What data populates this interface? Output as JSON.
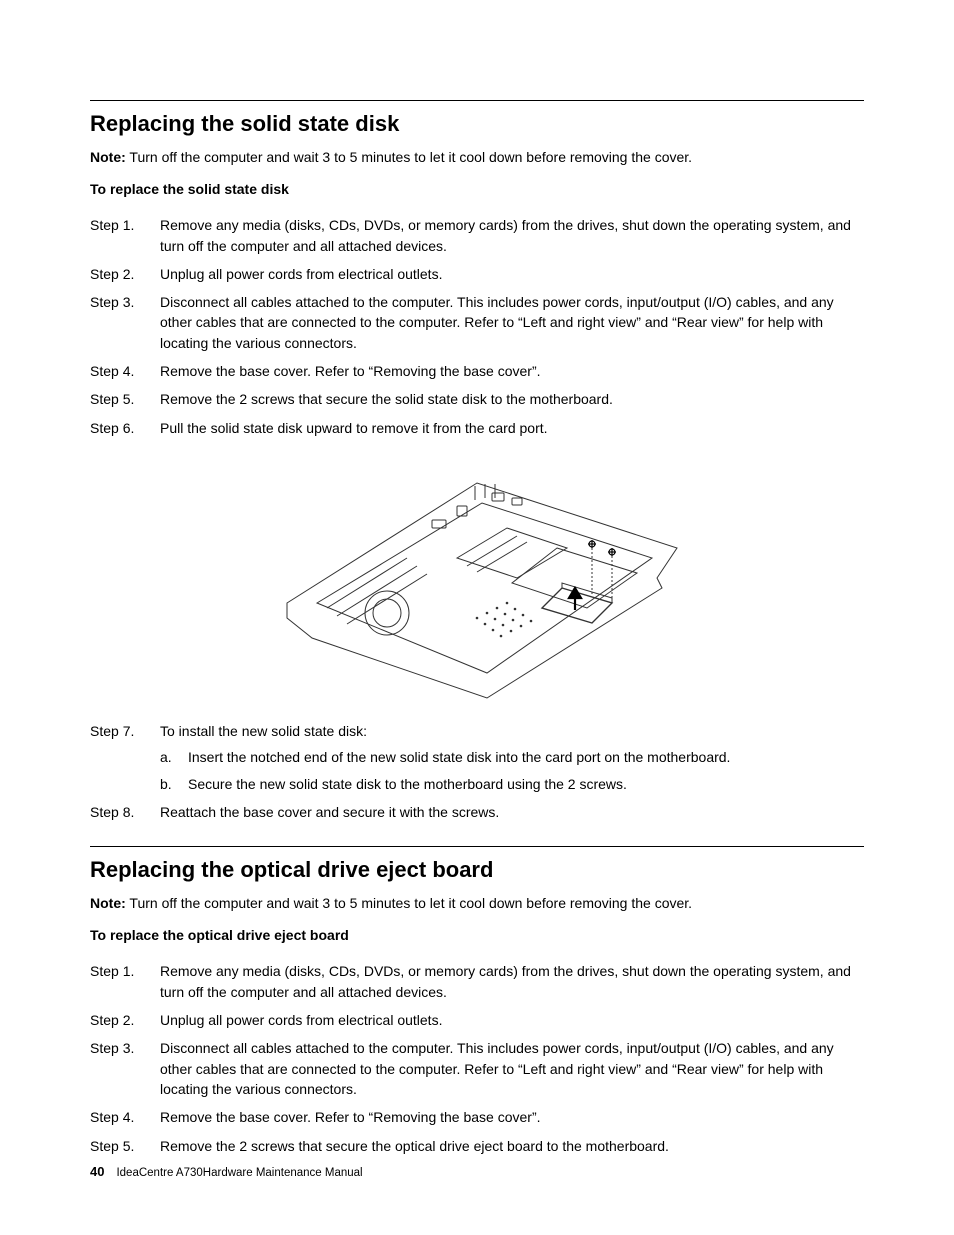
{
  "section1": {
    "title": "Replacing the solid state disk",
    "note_label": "Note:",
    "note_text": " Turn off the computer and wait 3 to 5 minutes to let it cool down before removing the cover.",
    "sub_heading": "To replace the solid state disk",
    "steps": [
      {
        "label": "Step 1.",
        "text": "Remove any media (disks, CDs, DVDs, or memory cards) from the drives, shut down the operating system, and turn off the computer and all attached devices."
      },
      {
        "label": "Step 2.",
        "text": "Unplug all power cords from electrical outlets."
      },
      {
        "label": "Step 3.",
        "text": "Disconnect all cables attached to the computer. This includes power cords, input/output (I/O) cables, and any other cables that are connected to the computer. Refer to “Left and right view” and “Rear view” for help with locating the various connectors."
      },
      {
        "label": "Step 4.",
        "text": "Remove the base cover. Refer to “Removing the base cover”."
      },
      {
        "label": "Step 5.",
        "text": "Remove the 2 screws that secure the solid state disk to the motherboard."
      },
      {
        "label": "Step 6.",
        "text": "Pull the solid state disk upward to remove it from the card port."
      }
    ],
    "step7": {
      "label": "Step 7.",
      "text": "To install the new solid state disk:",
      "sub": [
        {
          "label": "a.",
          "text": "Insert the notched end of the new solid state disk into the card port on the motherboard."
        },
        {
          "label": "b.",
          "text": "Secure the new solid state disk to the motherboard using the 2 screws."
        }
      ]
    },
    "step8": {
      "label": "Step 8.",
      "text": "Reattach the base cover and secure it with the screws."
    }
  },
  "section2": {
    "title": "Replacing the optical drive eject board",
    "note_label": "Note:",
    "note_text": " Turn off the computer and wait 3 to 5 minutes to let it cool down before removing the cover.",
    "sub_heading": "To replace the optical drive eject board",
    "steps": [
      {
        "label": "Step 1.",
        "text": "Remove any media (disks, CDs, DVDs, or memory cards) from the drives, shut down the operating system, and turn off the computer and all attached devices."
      },
      {
        "label": "Step 2.",
        "text": "Unplug all power cords from electrical outlets."
      },
      {
        "label": "Step 3.",
        "text": "Disconnect all cables attached to the computer. This includes power cords, input/output (I/O) cables, and any other cables that are connected to the computer. Refer to “Left and right view” and “Rear view” for help with locating the various connectors."
      },
      {
        "label": "Step 4.",
        "text": "Remove the base cover. Refer to “Removing the base cover”."
      },
      {
        "label": "Step 5.",
        "text": "Remove the 2 screws that secure the optical drive eject board to the motherboard."
      }
    ]
  },
  "footer": {
    "page_number": "40",
    "doc_title": "IdeaCentre A730Hardware Maintenance Manual"
  },
  "diagram": {
    "description": "Laptop motherboard line-art showing solid state disk removal with upward arrow and two screw indicators"
  }
}
